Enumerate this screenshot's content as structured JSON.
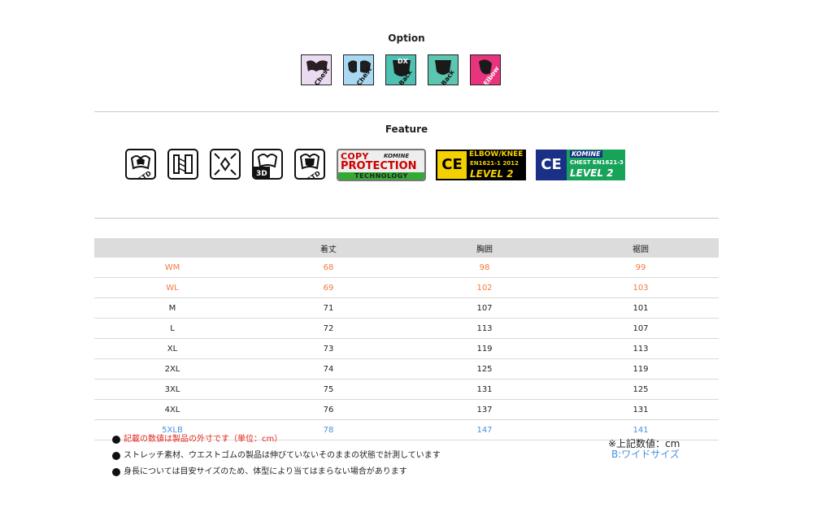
{
  "option": {
    "title": "Option",
    "icons": [
      {
        "name": "chest-pad-icon",
        "label": "Chest",
        "bg": "#eadbf0",
        "shape": "#2a1f25"
      },
      {
        "name": "chest-pad-blue-icon",
        "label": "Chest",
        "bg": "#a9d8f2",
        "shape": "#1e1e1e"
      },
      {
        "name": "dx-back-pad-icon",
        "badge": "DX",
        "label": "Back",
        "bg": "#4fc1b3",
        "shape": "#1a1a1a"
      },
      {
        "name": "back-pad-icon",
        "label": "Back",
        "bg": "#5cc6b0",
        "shape": "#1a1a1a"
      },
      {
        "name": "elbow-pad-icon",
        "label": "Elbow",
        "bg": "#e8347d",
        "shape": "#1a1a1a"
      }
    ]
  },
  "feature": {
    "title": "Feature",
    "icons": [
      {
        "name": "std-chest-protector-icon",
        "label": "STD"
      },
      {
        "name": "stretch-fabric-icon"
      },
      {
        "name": "fit-adjust-icon"
      },
      {
        "name": "3d-pattern-icon",
        "label": "3D pattern"
      },
      {
        "name": "std-back-protector-icon",
        "label": "STD"
      }
    ],
    "copy_protection": {
      "line1": "COPY",
      "brand": "KOMINE",
      "line2": "PROTECTION",
      "line3": "TECHNOLOGY"
    },
    "elbow_knee": {
      "ce": "CE",
      "title": "ELBOW/KNEE",
      "standard": "EN1621-1  2012",
      "level": "LEVEL 2"
    },
    "chest": {
      "ce": "CE",
      "brand": "KOMINE",
      "standard": "CHEST  EN1621-3",
      "level": "LEVEL 2"
    }
  },
  "size_table": {
    "headers": [
      "",
      "着丈",
      "胸囲",
      "裾囲"
    ],
    "rows": [
      {
        "size": "WM",
        "length": "68",
        "chest": "98",
        "hem": "99",
        "kind": "women"
      },
      {
        "size": "WL",
        "length": "69",
        "chest": "102",
        "hem": "103",
        "kind": "women"
      },
      {
        "size": "M",
        "length": "71",
        "chest": "107",
        "hem": "101",
        "kind": "standard"
      },
      {
        "size": "L",
        "length": "72",
        "chest": "113",
        "hem": "107",
        "kind": "standard"
      },
      {
        "size": "XL",
        "length": "73",
        "chest": "119",
        "hem": "113",
        "kind": "standard"
      },
      {
        "size": "2XL",
        "length": "74",
        "chest": "125",
        "hem": "119",
        "kind": "standard"
      },
      {
        "size": "3XL",
        "length": "75",
        "chest": "131",
        "hem": "125",
        "kind": "standard"
      },
      {
        "size": "4XL",
        "length": "76",
        "chest": "137",
        "hem": "131",
        "kind": "standard"
      },
      {
        "size": "5XLB",
        "length": "78",
        "chest": "147",
        "hem": "141",
        "kind": "wide"
      }
    ]
  },
  "notes": [
    "記載の数値は製品の外寸です（単位：cm）",
    "ストレッチ素材、ウエストゴムの製品は伸びていないそのままの状態で計測しています",
    "身長については目安サイズのため、体型により当てはまらない場合があります"
  ],
  "unit_note": "※上記数値：cm",
  "wide_note": "B:ワイドサイズ",
  "colors": {
    "women": "#f07a3e",
    "wide": "#4b8fe0",
    "warning": "#e2261b"
  }
}
